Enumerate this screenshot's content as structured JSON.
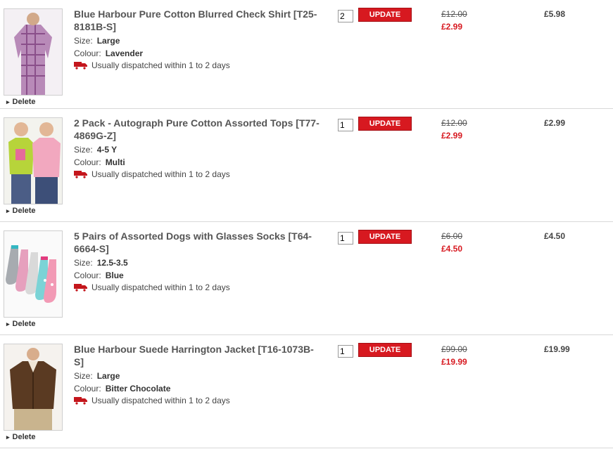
{
  "basket": {
    "items": [
      {
        "title": "Blue Harbour Pure Cotton Blurred Check Shirt [T25-8181B-S]",
        "size_label": "Size:",
        "size": "Large",
        "colour_label": "Colour:",
        "colour": "Lavender",
        "dispatch": "Usually dispatched within 1 to 2 days",
        "quantity": "2",
        "update_label": "UPDATE",
        "was_price": "£12.00",
        "now_price": "£2.99",
        "total": "£5.98",
        "delete_label": "Delete",
        "image_icon": "check-shirt-icon"
      },
      {
        "title": "2 Pack - Autograph Pure Cotton Assorted Tops [T77-4869G-Z]",
        "size_label": "Size:",
        "size": "4-5 Y",
        "colour_label": "Colour:",
        "colour": "Multi",
        "dispatch": "Usually dispatched within 1 to 2 days",
        "quantity": "1",
        "update_label": "UPDATE",
        "was_price": "£12.00",
        "now_price": "£2.99",
        "total": "£2.99",
        "delete_label": "Delete",
        "image_icon": "girls-tops-icon"
      },
      {
        "title": "5 Pairs of Assorted Dogs with Glasses Socks [T64-6664-S]",
        "size_label": "Size:",
        "size": "12.5-3.5",
        "colour_label": "Colour:",
        "colour": "Blue",
        "dispatch": "Usually dispatched within 1 to 2 days",
        "quantity": "1",
        "update_label": "UPDATE",
        "was_price": "£6.00",
        "now_price": "£4.50",
        "total": "£4.50",
        "delete_label": "Delete",
        "image_icon": "socks-icon"
      },
      {
        "title": "Blue Harbour Suede Harrington Jacket [T16-1073B-S]",
        "size_label": "Size:",
        "size": "Large",
        "colour_label": "Colour:",
        "colour": "Bitter Chocolate",
        "dispatch": "Usually dispatched within 1 to 2 days",
        "quantity": "1",
        "update_label": "UPDATE",
        "was_price": "£99.00",
        "now_price": "£19.99",
        "total": "£19.99",
        "delete_label": "Delete",
        "image_icon": "suede-jacket-icon"
      }
    ]
  },
  "colors": {
    "accent_red": "#d71920",
    "truck_red": "#c4161c",
    "divider": "#d8d8d8"
  }
}
